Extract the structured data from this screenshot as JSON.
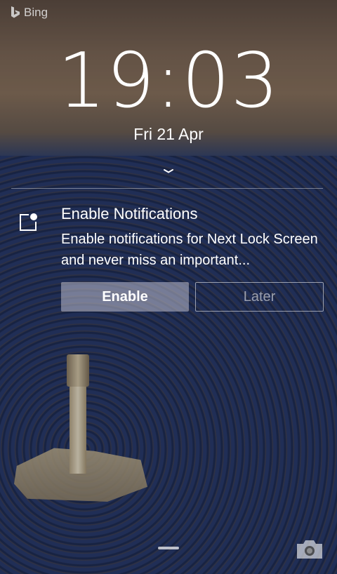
{
  "brand": {
    "name": "Bing",
    "icon": "bing-logo-icon"
  },
  "lockscreen": {
    "time": "19:03",
    "date": "Fri 21 Apr",
    "unlock_hint_icon": "chevron-down-icon"
  },
  "notification": {
    "icon": "notification-badge-icon",
    "title": "Enable Notifications",
    "body": "Enable notifications for Next Lock Screen and never miss an important...",
    "enable_label": "Enable",
    "later_label": "Later"
  },
  "bottom": {
    "home_handle": "home-handle",
    "camera_icon": "camera-icon"
  }
}
